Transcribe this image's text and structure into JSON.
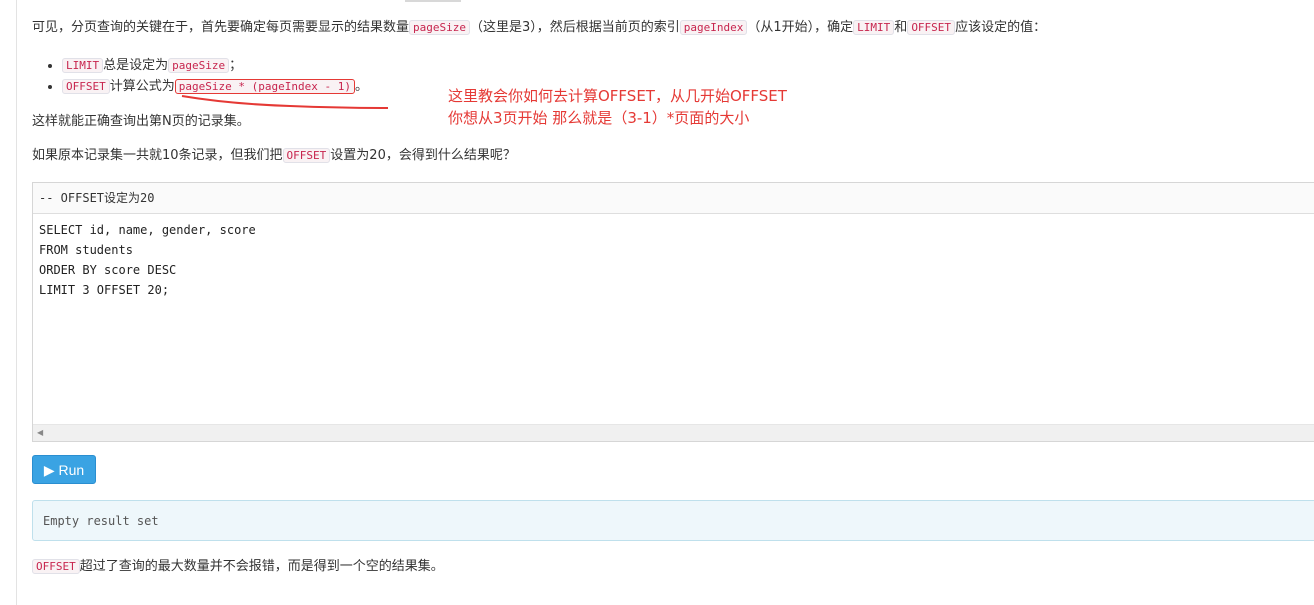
{
  "para1": {
    "t1": "可见，分页查询的关键在于，首先要确定每页需要显示的结果数量",
    "c1": "pageSize",
    "t2": "（这里是3），然后根据当前页的索引",
    "c2": "pageIndex",
    "t3": "（从1开始），确定",
    "c3": "LIMIT",
    "t4": "和",
    "c4": "OFFSET",
    "t5": "应该设定的值："
  },
  "bullets": [
    {
      "code1": "LIMIT",
      "text": "总是设定为",
      "code2": "pageSize",
      "tail": "；"
    },
    {
      "code1": "OFFSET",
      "text": "计算公式为",
      "code2": "pageSize * (pageIndex - 1)",
      "tail": "。"
    }
  ],
  "annotation": {
    "line1": "这里教会你如何去计算OFFSET，从几开始OFFSET",
    "line2": "你想从3页开始  那么就是（3-1）*页面的大小",
    "color": "#e53935"
  },
  "para2": "这样就能正确查询出第N页的记录集。",
  "para3": {
    "t1": "如果原本记录集一共就10条记录，但我们把",
    "code": "OFFSET",
    "t2": "设置为20，会得到什么结果呢？"
  },
  "editor": {
    "comment": "-- OFFSET设定为20",
    "code": "SELECT id, name, gender, score\nFROM students\nORDER BY score DESC\nLIMIT 3 OFFSET 20;"
  },
  "run_button": {
    "label": "Run",
    "icon": "play-icon"
  },
  "result": "Empty result set",
  "para4": {
    "code": "OFFSET",
    "text": "超过了查询的最大数量并不会报错，而是得到一个空的结果集。"
  }
}
